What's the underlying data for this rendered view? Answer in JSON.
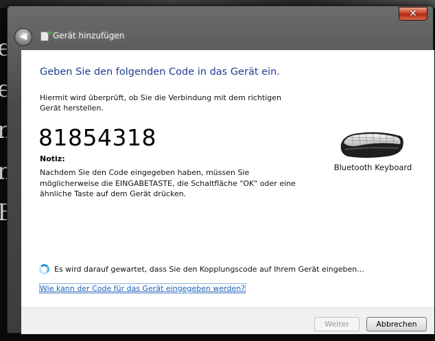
{
  "background": {
    "glyphs": [
      "e",
      "e",
      "n",
      "n",
      "B"
    ]
  },
  "window": {
    "title": "Gerät hinzufügen",
    "close_glyph": "✕",
    "back_glyph": "◀"
  },
  "content": {
    "heading": "Geben Sie den folgenden Code in das Gerät ein.",
    "intro": "Hiermit wird überprüft, ob Sie die Verbindung mit dem richtigen Gerät herstellen.",
    "code": "81854318",
    "note_title": "Notiz:",
    "note_text": "Nachdem Sie den Code eingegeben haben, müssen Sie möglicherweise die EINGABETASTE, die Schaltfläche \"OK\" oder eine ähnliche Taste auf dem Gerät drücken.",
    "device_label": "Bluetooth Keyboard",
    "status": "Es wird darauf gewartet, dass Sie den Kopplungscode auf Ihrem Gerät eingeben...",
    "help_link": "Wie kann der Code für das Gerät eingegeben werden?"
  },
  "footer": {
    "next_label": "Weiter",
    "cancel_label": "Abbrechen"
  },
  "colors": {
    "heading": "#1e3d8f",
    "link": "#1a5fb4",
    "close": "#c8412a"
  },
  "icons": {
    "device": "keyboard-icon",
    "status": "spinner-icon",
    "back": "back-arrow-icon"
  }
}
